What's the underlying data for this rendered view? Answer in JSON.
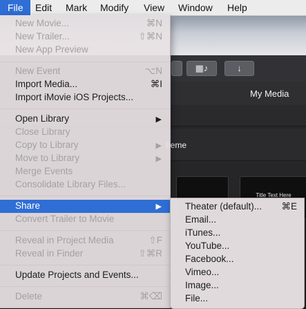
{
  "menubar": {
    "items": [
      "File",
      "Edit",
      "Mark",
      "Modify",
      "View",
      "Window",
      "Help"
    ]
  },
  "background": {
    "my_media_label": "My Media",
    "theme_label": "heme",
    "thumb_title": "Title Text Here",
    "toolbar_icons": [
      "film-music-icon",
      "download-arrow-icon"
    ]
  },
  "file_menu": {
    "new_movie": {
      "label": "New Movie...",
      "shortcut": "⌘N"
    },
    "new_trailer": {
      "label": "New Trailer...",
      "shortcut": "⇧⌘N"
    },
    "new_app_preview": {
      "label": "New App Preview"
    },
    "new_event": {
      "label": "New Event",
      "shortcut": "⌥N"
    },
    "import_media": {
      "label": "Import Media...",
      "shortcut": "⌘I"
    },
    "import_ios": {
      "label": "Import iMovie iOS Projects..."
    },
    "open_library": {
      "label": "Open Library"
    },
    "close_library": {
      "label": "Close Library"
    },
    "copy_to_library": {
      "label": "Copy to Library"
    },
    "move_to_library": {
      "label": "Move to Library"
    },
    "merge_events": {
      "label": "Merge Events"
    },
    "consolidate": {
      "label": "Consolidate Library Files..."
    },
    "share": {
      "label": "Share"
    },
    "convert_trailer": {
      "label": "Convert Trailer to Movie"
    },
    "reveal_project_media": {
      "label": "Reveal in Project Media",
      "shortcut": "⇧F"
    },
    "reveal_finder": {
      "label": "Reveal in Finder",
      "shortcut": "⇧⌘R"
    },
    "update_projects": {
      "label": "Update Projects and Events..."
    },
    "delete": {
      "label": "Delete",
      "shortcut": "⌘⌫"
    }
  },
  "share_menu": {
    "theater": {
      "label": "Theater (default)...",
      "shortcut": "⌘E"
    },
    "email": {
      "label": "Email..."
    },
    "itunes": {
      "label": "iTunes..."
    },
    "youtube": {
      "label": "YouTube..."
    },
    "facebook": {
      "label": "Facebook..."
    },
    "vimeo": {
      "label": "Vimeo..."
    },
    "image": {
      "label": "Image..."
    },
    "file": {
      "label": "File..."
    }
  },
  "colors": {
    "highlight": "#2f6ed5",
    "menu_bg": "#e8e2e4",
    "disabled_text": "#a4a0a2"
  }
}
